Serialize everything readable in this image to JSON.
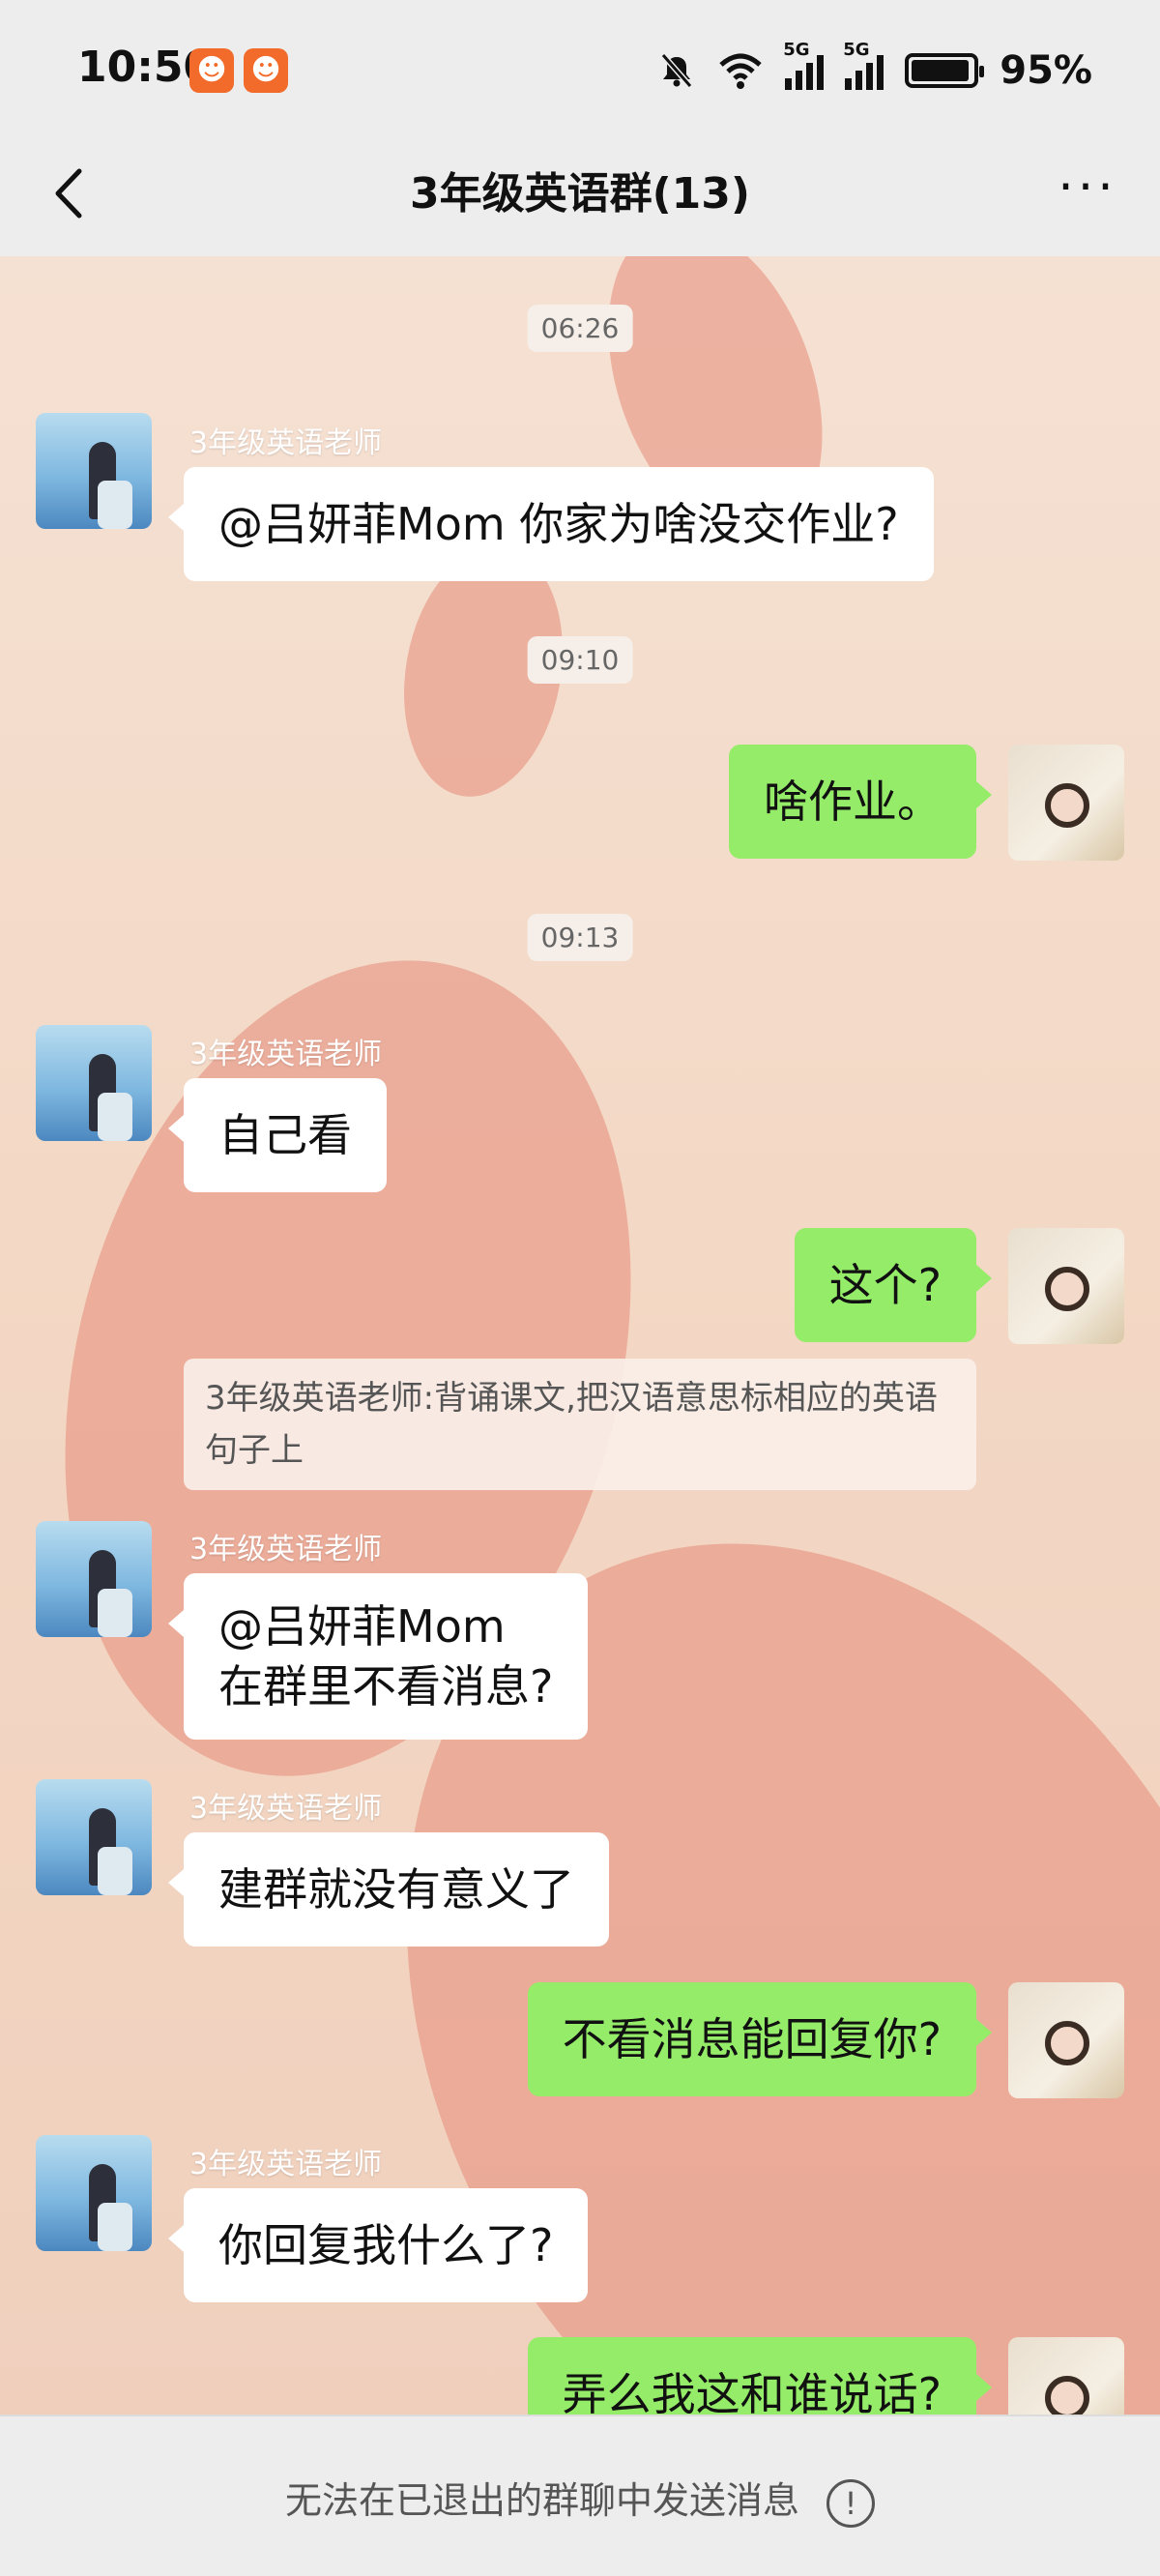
{
  "status_bar": {
    "time": "10:50",
    "network_1": "5G",
    "network_2": "5G",
    "battery": "95%",
    "battery_level": 0.95
  },
  "nav": {
    "title": "3年级英语群(13)",
    "more": "···"
  },
  "messages": [
    {
      "type": "time",
      "text": "06:26"
    },
    {
      "type": "in",
      "sender": "3年级英语老师",
      "text": "@吕妍菲Mom 你家为啥没交作业?"
    },
    {
      "type": "time",
      "text": "09:10"
    },
    {
      "type": "out",
      "text": "啥作业。"
    },
    {
      "type": "time",
      "text": "09:13"
    },
    {
      "type": "in",
      "sender": "3年级英语老师",
      "text": "自己看"
    },
    {
      "type": "out",
      "text": "这个?"
    },
    {
      "type": "quote",
      "text": "3年级英语老师:背诵课文,把汉语意思标相应的英语句子上"
    },
    {
      "type": "in",
      "sender": "3年级英语老师",
      "lines": [
        "@吕妍菲Mom",
        "在群里不看消息?"
      ]
    },
    {
      "type": "in",
      "sender": "3年级英语老师",
      "text": "建群就没有意义了"
    },
    {
      "type": "out",
      "text": "不看消息能回复你?"
    },
    {
      "type": "in",
      "sender": "3年级英语老师",
      "text": "你回复我什么了?"
    },
    {
      "type": "out",
      "text": "弄么我这和谁说话?"
    }
  ],
  "bottom": {
    "notice": "无法在已退出的群聊中发送消息",
    "icon": "!"
  },
  "colors": {
    "out_bubble": "#95ec69",
    "in_bubble": "#ffffff",
    "chrome": "#ededed"
  }
}
